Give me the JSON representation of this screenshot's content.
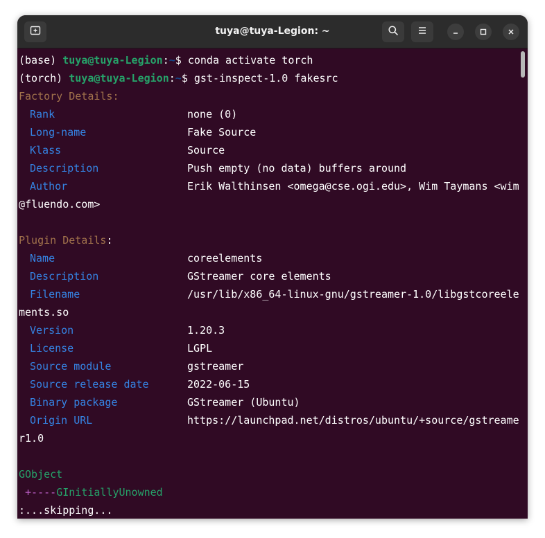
{
  "window": {
    "title": "tuya@tuya-Legion: ~"
  },
  "icons": {
    "new_tab": "new-tab-icon",
    "search": "search-icon",
    "menu": "hamburger-menu-icon",
    "minimize": "minimize-icon",
    "maximize": "maximize-icon",
    "close": "close-icon"
  },
  "colors": {
    "terminal_bg": "#300a24",
    "titlebar_bg": "#2c2c2c",
    "prompt_user": "#26a269",
    "prompt_path": "#12488b",
    "section": "#a2734c",
    "key": "#3584e4",
    "hierarchy_branch": "#c061cb"
  },
  "terminal": {
    "prompt1": {
      "env": "(base) ",
      "user": "tuya@tuya-Legion",
      "colon": ":",
      "path": "~",
      "symbol": "$ ",
      "command": "conda activate torch"
    },
    "prompt2": {
      "env": "(torch) ",
      "user": "tuya@tuya-Legion",
      "colon": ":",
      "path": "~",
      "symbol": "$ ",
      "command": "gst-inspect-1.0 fakesrc"
    },
    "factory": {
      "header": "Factory Details:",
      "rows": [
        {
          "key": "Rank",
          "value": "none (0)"
        },
        {
          "key": "Long-name",
          "value": "Fake Source"
        },
        {
          "key": "Klass",
          "value": "Source"
        },
        {
          "key": "Description",
          "value": "Push empty (no data) buffers around"
        },
        {
          "key": "Author",
          "value": "Erik Walthinsen <omega@cse.ogi.edu>, Wim Taymans <wim"
        }
      ],
      "author_wrap": "@fluendo.com>"
    },
    "plugin": {
      "header": "Plugin Details",
      "header_colon": ":",
      "rows": [
        {
          "key": "Name",
          "value": "coreelements"
        },
        {
          "key": "Description",
          "value": "GStreamer core elements"
        },
        {
          "key": "Filename",
          "value": "/usr/lib/x86_64-linux-gnu/gstreamer-1.0/libgstcoreele"
        },
        {
          "key": "Version",
          "value": "1.20.3"
        },
        {
          "key": "License",
          "value": "LGPL"
        },
        {
          "key": "Source module",
          "value": "gstreamer"
        },
        {
          "key": "Source release date",
          "value": "2022-06-15"
        },
        {
          "key": "Binary package",
          "value": "GStreamer (Ubuntu)"
        },
        {
          "key": "Origin URL",
          "value": "https://launchpad.net/distros/ubuntu/+source/gstreame"
        }
      ],
      "filename_wrap": "ments.so",
      "url_wrap": "r1.0"
    },
    "hierarchy": {
      "root": "GObject",
      "branch": " +----",
      "child": "GInitiallyUnowned"
    },
    "pager": ":...skipping..."
  }
}
